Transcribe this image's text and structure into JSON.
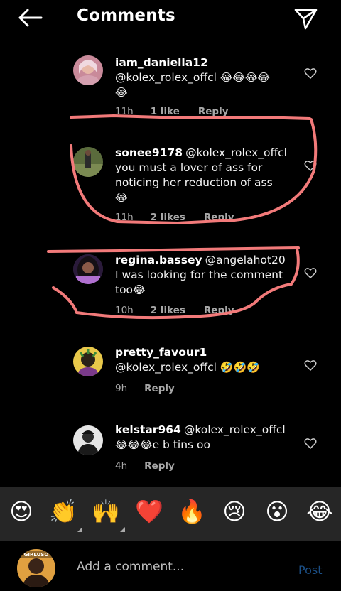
{
  "header": {
    "title": "Comments"
  },
  "comments": [
    {
      "username": "iam_daniella12",
      "text": "@kolex_rolex_offcl ",
      "emoji": "😂😂😂😂",
      "line2_emoji": "😂",
      "time": "11h",
      "likes": "1 like",
      "reply": "Reply"
    },
    {
      "username": "sonee9178",
      "text": "@kolex_rolex_offcl you must a lover of ass for noticing her reduction of ass",
      "emoji": "😂",
      "time": "11h",
      "likes": "2 likes",
      "reply": "Reply"
    },
    {
      "username": "regina.bassey",
      "text": "@angelahot20 I was looking for the comment too",
      "emoji": "😂",
      "time": "10h",
      "likes": "2 likes",
      "reply": "Reply"
    },
    {
      "username": "pretty_favour1",
      "text": "@kolex_rolex_offcl ",
      "emoji": "🤣🤣🤣",
      "time": "9h",
      "reply": "Reply"
    },
    {
      "username": "kelstar964",
      "text": "@kolex_rolex_offcl",
      "emoji": "😂😂😂",
      "text2": "e b tins oo",
      "time": "4h",
      "reply": "Reply"
    }
  ],
  "emoji_bar": [
    "😍",
    "👏",
    "🙌",
    "❤️",
    "🔥",
    "😢",
    "😮",
    "😂"
  ],
  "composer": {
    "placeholder": "Add a comment...",
    "post_label": "Post",
    "avatar_caption": "GIRLUSO"
  },
  "colors": {
    "background": "#000000",
    "annotation": "#f27a7a",
    "post": "#1b4f86",
    "emoji_bar": "#262626"
  }
}
